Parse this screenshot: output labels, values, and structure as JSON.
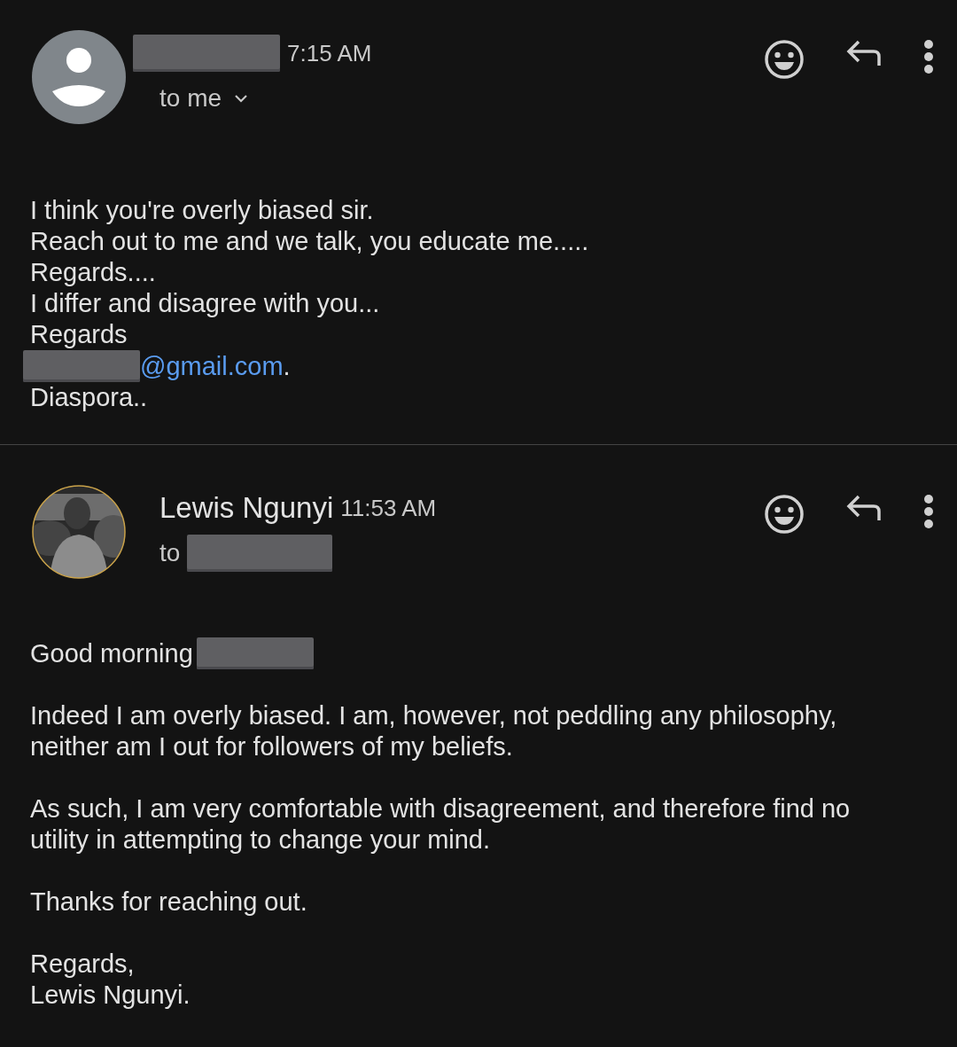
{
  "messages": [
    {
      "avatar": {
        "kind": "placeholder"
      },
      "sender": {
        "redacted": true
      },
      "time": "7:15 AM",
      "recipient": {
        "prefix": "to me",
        "redacted": false,
        "expandable": true
      },
      "paragraphs": [
        [
          [
            {
              "kind": "text",
              "text": "I think you're overly biased sir."
            }
          ],
          [
            {
              "kind": "text",
              "text": "Reach out to me and we talk, you educate me....."
            }
          ],
          [
            {
              "kind": "text",
              "text": "Regards...."
            }
          ],
          [
            {
              "kind": "text",
              "text": "I differ and disagree with you..."
            }
          ],
          [
            {
              "kind": "text",
              "text": "Regards"
            }
          ],
          [
            {
              "kind": "redacted"
            },
            {
              "kind": "link",
              "text": "@gmail.com"
            },
            {
              "kind": "text",
              "text": "."
            }
          ],
          [
            {
              "kind": "text",
              "text": "Diaspora.."
            }
          ]
        ]
      ]
    },
    {
      "avatar": {
        "kind": "picture"
      },
      "sender": {
        "redacted": false,
        "name": "Lewis Ngunyi"
      },
      "time": "11:53 AM",
      "recipient": {
        "prefix": "to",
        "redacted": true,
        "expandable": false
      },
      "paragraphs": [
        [
          [
            {
              "kind": "text",
              "text": "Good morning"
            },
            {
              "kind": "redacted"
            }
          ]
        ],
        [
          [
            {
              "kind": "text",
              "text": "Indeed I am overly biased. I am, however, not peddling any philosophy,"
            }
          ],
          [
            {
              "kind": "text",
              "text": "neither am I out for followers of my beliefs."
            }
          ]
        ],
        [
          [
            {
              "kind": "text",
              "text": "As such, I am very comfortable with disagreement, and therefore find no"
            }
          ],
          [
            {
              "kind": "text",
              "text": "utility in attempting to change your mind."
            }
          ]
        ],
        [
          [
            {
              "kind": "text",
              "text": "Thanks for reaching out."
            }
          ]
        ],
        [
          [
            {
              "kind": "text",
              "text": "Regards,"
            }
          ],
          [
            {
              "kind": "text",
              "text": "Lewis Ngunyi."
            }
          ]
        ]
      ]
    }
  ]
}
